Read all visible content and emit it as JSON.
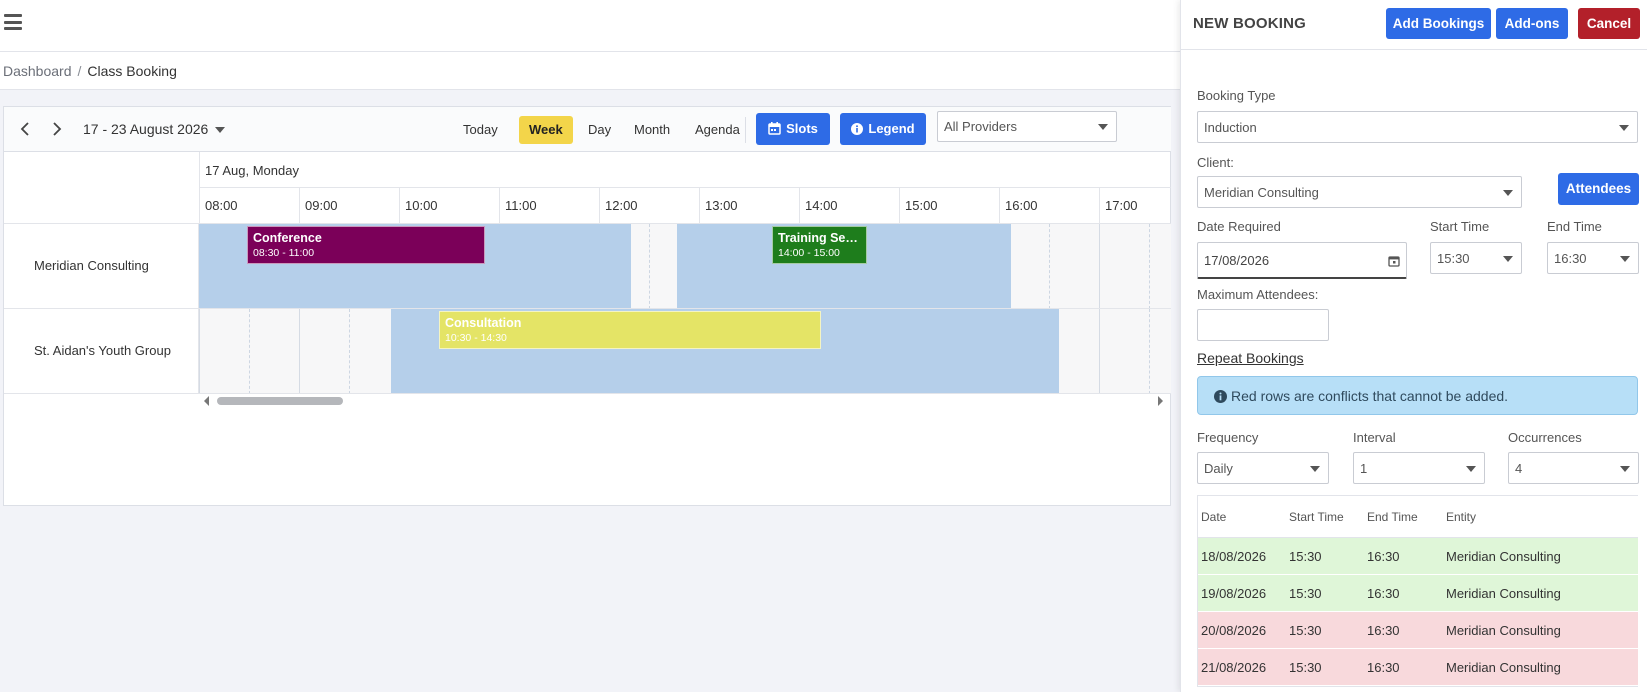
{
  "breadcrumb": {
    "parent": "Dashboard",
    "separator": "/",
    "current": "Class Booking"
  },
  "calendar": {
    "date_range": "17 - 23 August 2026",
    "views": {
      "today": "Today",
      "week": "Week",
      "day": "Day",
      "month": "Month",
      "agenda": "Agenda"
    },
    "active_view": "Week",
    "slots_label": "Slots",
    "legend_label": "Legend",
    "provider_filter": "All Providers",
    "day_header": "17 Aug, Monday",
    "hours": [
      "08:00",
      "09:00",
      "10:00",
      "11:00",
      "12:00",
      "13:00",
      "14:00",
      "15:00",
      "16:00",
      "17:00"
    ],
    "resources": [
      {
        "name": "Meridian Consulting",
        "events": [
          {
            "title": "Conference",
            "time": "08:30 - 11:00",
            "color": "#7b0059"
          },
          {
            "title": "Training Session",
            "time": "14:00 - 15:00",
            "color": "#1e7d1c"
          }
        ]
      },
      {
        "name": "St. Aidan's Youth Group",
        "events": [
          {
            "title": "Consultation",
            "time": "10:30 - 14:30",
            "color": "#e4e466"
          }
        ]
      }
    ],
    "availability_color": "#b5cfea"
  },
  "drawer": {
    "title": "NEW BOOKING",
    "add_bookings_label": "Add Bookings",
    "addons_label": "Add-ons",
    "cancel_label": "Cancel",
    "booking_type_label": "Booking Type",
    "booking_type_value": "Induction",
    "client_label": "Client:",
    "client_value": "Meridian Consulting",
    "attendees_label": "Attendees",
    "date_required_label": "Date Required",
    "date_required_value": "17/08/2026",
    "start_time_label": "Start Time",
    "start_time_value": "15:30",
    "end_time_label": "End Time",
    "end_time_value": "16:30",
    "max_attendees_label": "Maximum Attendees:",
    "max_attendees_value": "",
    "repeat_bookings_label": "Repeat Bookings",
    "conflict_notice": "Red rows are conflicts that cannot be added.",
    "frequency_label": "Frequency",
    "frequency_value": "Daily",
    "interval_label": "Interval",
    "interval_value": "1",
    "occurrences_label": "Occurrences",
    "occurrences_value": "4",
    "table": {
      "headers": [
        "Date",
        "Start Time",
        "End Time",
        "Entity"
      ],
      "rows": [
        {
          "date": "18/08/2026",
          "start": "15:30",
          "end": "16:30",
          "entity": "Meridian Consulting",
          "status": "ok"
        },
        {
          "date": "19/08/2026",
          "start": "15:30",
          "end": "16:30",
          "entity": "Meridian Consulting",
          "status": "ok"
        },
        {
          "date": "20/08/2026",
          "start": "15:30",
          "end": "16:30",
          "entity": "Meridian Consulting",
          "status": "conflict"
        },
        {
          "date": "21/08/2026",
          "start": "15:30",
          "end": "16:30",
          "entity": "Meridian Consulting",
          "status": "conflict"
        }
      ]
    }
  },
  "colors": {
    "primary": "#2e6be6",
    "danger": "#b3202a",
    "active_view": "#f3d54a",
    "ok_row": "#dff6d8",
    "conflict_row": "#f8d9dc"
  }
}
